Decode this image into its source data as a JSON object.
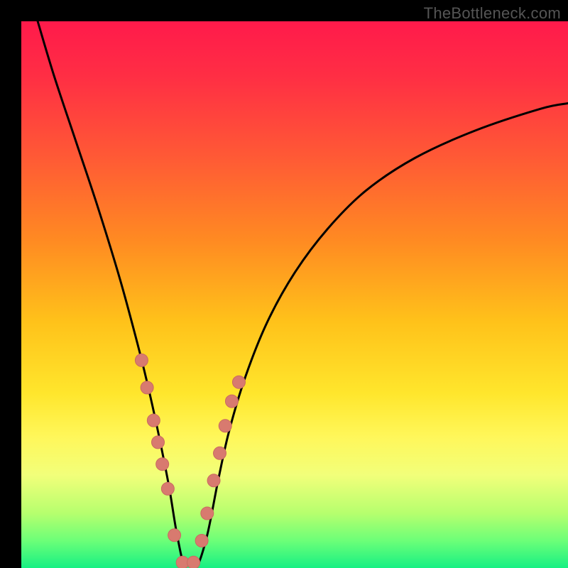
{
  "attribution": "TheBottleneck.com",
  "colors": {
    "page_bg": "#000000",
    "attribution_text": "#555555",
    "curve_stroke": "#000000",
    "marker_fill": "#d87a6f",
    "marker_stroke": "#c96a60",
    "gradient_stops": [
      {
        "offset": 0.0,
        "color": "#ff1a4b"
      },
      {
        "offset": 0.1,
        "color": "#ff2e44"
      },
      {
        "offset": 0.25,
        "color": "#ff5a35"
      },
      {
        "offset": 0.4,
        "color": "#ff8a22"
      },
      {
        "offset": 0.55,
        "color": "#ffc21a"
      },
      {
        "offset": 0.68,
        "color": "#ffe62c"
      },
      {
        "offset": 0.76,
        "color": "#fff75a"
      },
      {
        "offset": 0.83,
        "color": "#f2ff7a"
      },
      {
        "offset": 0.9,
        "color": "#b6ff6e"
      },
      {
        "offset": 0.95,
        "color": "#6cff78"
      },
      {
        "offset": 1.0,
        "color": "#17f083"
      }
    ]
  },
  "chart_data": {
    "type": "line",
    "title": "",
    "xlabel": "",
    "ylabel": "",
    "xlim": [
      0,
      100
    ],
    "ylim": [
      0,
      100
    ],
    "grid": false,
    "legend": false,
    "series": [
      {
        "name": "bottleneck-curve",
        "x": [
          3,
          6,
          10,
          14,
          18,
          21,
          23,
          25,
          27,
          28.5,
          30,
          32,
          34,
          36,
          38,
          41,
          45,
          50,
          56,
          63,
          72,
          83,
          95,
          100
        ],
        "y": [
          100,
          90,
          78,
          66,
          53,
          42,
          34,
          25,
          15,
          6,
          0,
          0,
          6,
          16,
          25,
          35,
          45,
          54,
          62,
          69,
          75,
          80,
          84,
          85
        ]
      }
    ],
    "markers": {
      "name": "highlighted-points",
      "x": [
        22.0,
        23.0,
        24.2,
        25.0,
        25.8,
        26.8,
        28.0,
        29.5,
        31.5,
        33.0,
        34.0,
        35.2,
        36.3,
        37.3,
        38.5,
        39.8
      ],
      "y": [
        38.0,
        33.0,
        27.0,
        23.0,
        19.0,
        14.5,
        6.0,
        1.0,
        1.0,
        5.0,
        10.0,
        16.0,
        21.0,
        26.0,
        30.5,
        34.0
      ]
    }
  }
}
